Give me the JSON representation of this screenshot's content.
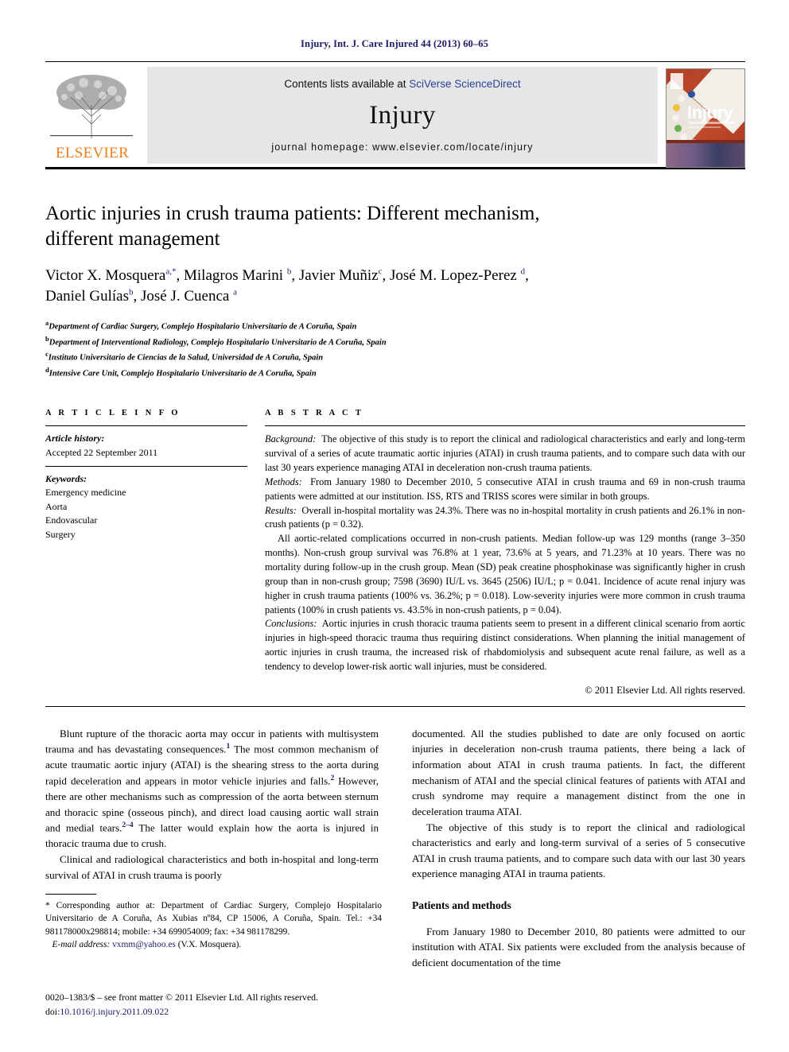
{
  "running_head": "Injury, Int. J. Care Injured 44 (2013) 60–65",
  "masthead": {
    "contents_prefix": "Contents lists available at ",
    "sciencedirect": "SciVerse ScienceDirect",
    "journal_title": "Injury",
    "homepage": "journal homepage: www.elsevier.com/locate/injury",
    "publisher_wordmark": "ELSEVIER",
    "cover_title": "Injury",
    "sciencedirect_color": "#2b3f9e",
    "elsevier_orange": "#ef7d1a",
    "band_color": "#e6e6e6"
  },
  "title": "Aortic injuries in crush trauma patients: Different mechanism, different management",
  "authors": [
    {
      "name": "Victor X. Mosquera",
      "sup": "a,*"
    },
    {
      "name": "Milagros Marini",
      "sup": "b"
    },
    {
      "name": "Javier Muñiz",
      "sup": "c"
    },
    {
      "name": "José M. Lopez-Perez",
      "sup": "d"
    },
    {
      "name": "Daniel Gulías",
      "sup": "b"
    },
    {
      "name": "José J. Cuenca",
      "sup": "a"
    }
  ],
  "affiliations": [
    {
      "mark": "a",
      "text": "Department of Cardiac Surgery, Complejo Hospitalario Universitario de A Coruña, Spain"
    },
    {
      "mark": "b",
      "text": "Department of Interventional Radiology, Complejo Hospitalario Universitario de A Coruña, Spain"
    },
    {
      "mark": "c",
      "text": "Instituto Universitario de Ciencias de la Salud, Universidad de A Coruña, Spain"
    },
    {
      "mark": "d",
      "text": "Intensive Care Unit, Complejo Hospitalario Universitario de A Coruña, Spain"
    }
  ],
  "article_info": {
    "heading": "A R T I C L E   I N F O",
    "history_label": "Article history:",
    "history_value": "Accepted 22 September 2011",
    "keywords_label": "Keywords:",
    "keywords": [
      "Emergency medicine",
      "Aorta",
      "Endovascular",
      "Surgery"
    ]
  },
  "abstract": {
    "heading": "A B S T R A C T",
    "background_label": "Background:",
    "background_text": "The objective of this study is to report the clinical and radiological characteristics and early and long-term survival of a series of acute traumatic aortic injuries (ATAI) in crush trauma patients, and to compare such data with our last 30 years experience managing ATAI in deceleration non-crush trauma patients.",
    "methods_label": "Methods:",
    "methods_text": "From January 1980 to December 2010, 5 consecutive ATAI in crush trauma and 69 in non-crush trauma patients were admitted at our institution. ISS, RTS and TRISS scores were similar in both groups.",
    "results_label": "Results:",
    "results_text": "Overall in-hospital mortality was 24.3%. There was no in-hospital mortality in crush patients and 26.1% in non-crush patients (p = 0.32).",
    "results_para2": "All aortic-related complications occurred in non-crush patients. Median follow-up was 129 months (range 3–350 months). Non-crush group survival was 76.8% at 1 year, 73.6% at 5 years, and 71.23% at 10 years. There was no mortality during follow-up in the crush group. Mean (SD) peak creatine phosphokinase was significantly higher in crush group than in non-crush group; 7598 (3690) IU/L vs. 3645 (2506) IU/L; p = 0.041. Incidence of acute renal injury was higher in crush trauma patients (100% vs. 36.2%; p = 0.018). Low-severity injuries were more common in crush trauma patients (100% in crush patients vs. 43.5% in non-crush patients, p = 0.04).",
    "conclusions_label": "Conclusions:",
    "conclusions_text": "Aortic injuries in crush thoracic trauma patients seem to present in a different clinical scenario from aortic injuries in high-speed thoracic trauma thus requiring distinct considerations. When planning the initial management of aortic injuries in crush trauma, the increased risk of rhabdomiolysis and subsequent acute renal failure, as well as a tendency to develop lower-risk aortic wall injuries, must be considered.",
    "copyright": "© 2011 Elsevier Ltd. All rights reserved."
  },
  "body": {
    "left_p1_a": "Blunt rupture of the thoracic aorta may occur in patients with multisystem trauma and has devastating consequences.",
    "left_p1_s1": "1",
    "left_p1_b": " The most common mechanism of acute traumatic aortic injury (ATAI) is the shearing stress to the aorta during rapid deceleration and appears in motor vehicle injuries and falls.",
    "left_p1_s2": "2",
    "left_p1_c": " However, there are other mechanisms such as compression of the aorta between sternum and thoracic spine (osseous pinch), and direct load causing aortic wall strain and medial tears.",
    "left_p1_s3": "2–4",
    "left_p1_d": " The latter would explain how the aorta is injured in thoracic trauma due to crush.",
    "left_p2": "Clinical and radiological characteristics and both in-hospital and long-term survival of ATAI in crush trauma is poorly",
    "right_p1": "documented. All the studies published to date are only focused on aortic injuries in deceleration non-crush trauma patients, there being a lack of information about ATAI in crush trauma patients. In fact, the different mechanism of ATAI and the special clinical features of patients with ATAI and crush syndrome may require a management distinct from the one in deceleration trauma ATAI.",
    "right_p2": "The objective of this study is to report the clinical and radiological characteristics and early and long-term survival of a series of 5 consecutive ATAI in crush trauma patients, and to compare such data with our last 30 years experience managing ATAI in trauma patients.",
    "section_heading": "Patients and methods",
    "right_p3": "From January 1980 to December 2010, 80 patients were admitted to our institution with ATAI. Six patients were excluded from the analysis because of deficient documentation of the time"
  },
  "footnote": {
    "star": "*",
    "corresponding_text": " Corresponding author at: Department of Cardiac Surgery, Complejo Hospitalario Universitario de A Coruña, As Xubias nº84, CP 15006, A Coruña, Spain. Tel.: +34 981178000x298814; mobile: +34 699054009; fax: +34 981178299.",
    "email_label": "E-mail address:",
    "email": "vxmm@yahoo.es",
    "email_owner": "(V.X. Mosquera)."
  },
  "issn": {
    "line1": "0020–1383/$ – see front matter © 2011 Elsevier Ltd. All rights reserved.",
    "doi_prefix": "doi:",
    "doi_link": "10.1016/j.injury.2011.09.022"
  }
}
